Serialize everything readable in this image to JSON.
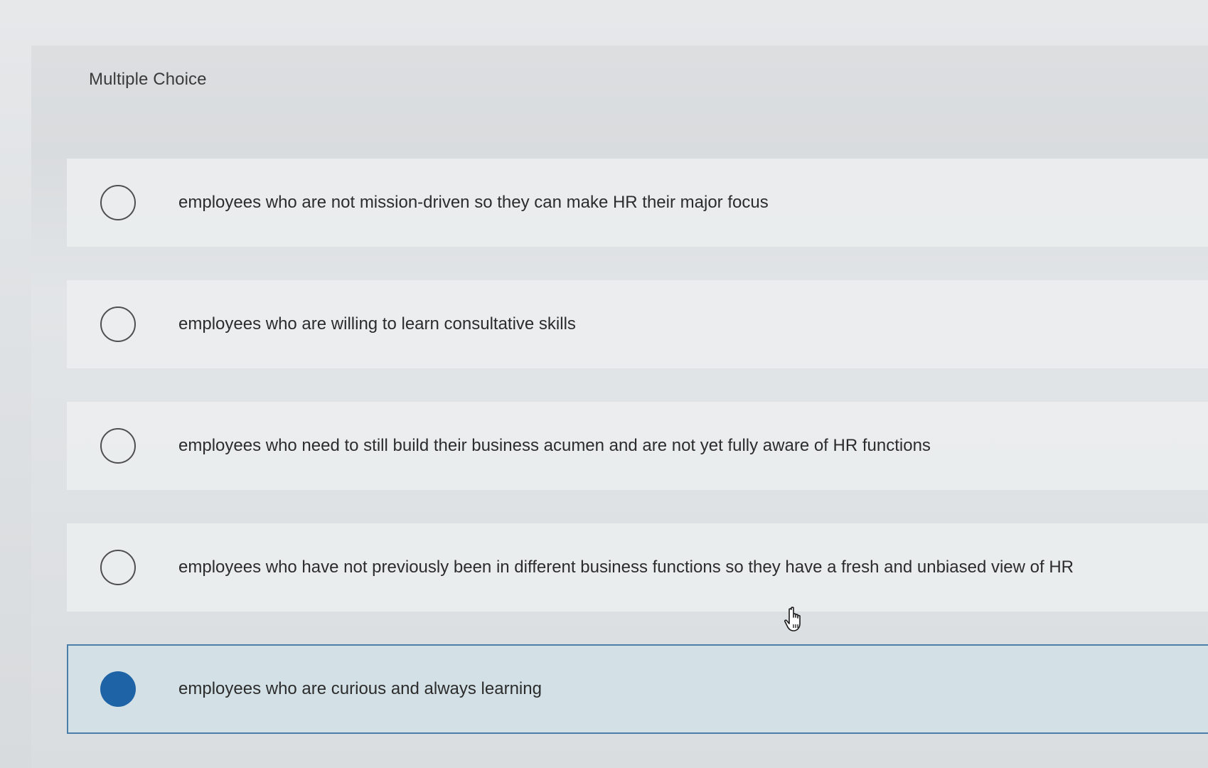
{
  "question": {
    "type_label": "Multiple Choice"
  },
  "choices": [
    {
      "label": "employees who are not mission-driven so they can make HR their major focus",
      "selected": false
    },
    {
      "label": "employees who are willing to learn consultative skills",
      "selected": false
    },
    {
      "label": "employees who need to still build their business acumen and are not yet fully aware of HR functions",
      "selected": false
    },
    {
      "label": "employees who have not previously been in different business functions so they have a fresh and unbiased view of HR",
      "selected": false
    },
    {
      "label": "employees who are curious and always learning",
      "selected": true
    }
  ],
  "colors": {
    "selected_fill": "#1e63a6",
    "selected_border": "#4b7fa9",
    "selected_background": "#d3e1e6"
  },
  "cursor": {
    "icon": "hand-pointer-icon"
  }
}
